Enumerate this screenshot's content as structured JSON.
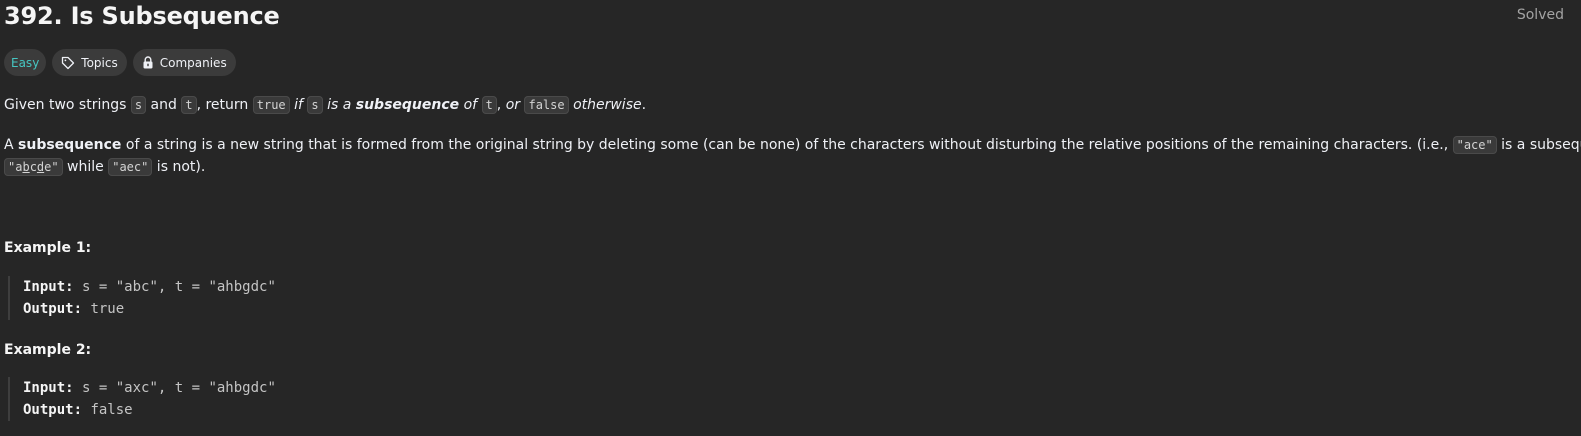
{
  "header": {
    "title": "392. Is Subsequence",
    "status": "Solved"
  },
  "tags": {
    "difficulty": "Easy",
    "topics": "Topics",
    "companies": "Companies"
  },
  "description": {
    "p1": {
      "t1": "Given two strings ",
      "c1": "s",
      "t2": " and ",
      "c2": "t",
      "t3": ", return ",
      "c3": "true",
      "t4": " ",
      "i1": "if",
      "t5": " ",
      "c4": "s",
      "t6": " ",
      "i2": "is a",
      "t7": " ",
      "b1": "subsequence",
      "t8": " ",
      "i3": "of",
      "t9": " ",
      "c5": "t",
      "t10": ", ",
      "i4": "or",
      "t11": " ",
      "c6": "false",
      "t12": " ",
      "i5": "otherwise",
      "t13": "."
    },
    "p2": {
      "t1": "A ",
      "b1": "subsequence",
      "t2": " of a string is a new string that is formed from the original string by deleting some (can be none) of the characters without disturbing the relative positions of the remaining characters. (i.e., ",
      "c1": "\"ace\"",
      "t3": " is a subsequence of",
      "c2a": "\"a",
      "c2b": "b",
      "c2c": "c",
      "c2d": "d",
      "c2e": "e\"",
      "t4": " while ",
      "c3": "\"aec\"",
      "t5": " is not)."
    }
  },
  "examples": [
    {
      "title": "Example 1:",
      "input_label": "Input:",
      "input_value": "s = \"abc\", t = \"ahbgdc\"",
      "output_label": "Output:",
      "output_value": "true"
    },
    {
      "title": "Example 2:",
      "input_label": "Input:",
      "input_value": "s = \"axc\", t = \"ahbgdc\"",
      "output_label": "Output:",
      "output_value": "false"
    }
  ],
  "colors": {
    "background": "#262626",
    "easy": "#46c6c2",
    "tag_bg": "#3b3b3b",
    "text": "#eff1f6"
  },
  "icons": {
    "topics": "tag-icon",
    "companies": "lock-icon"
  }
}
